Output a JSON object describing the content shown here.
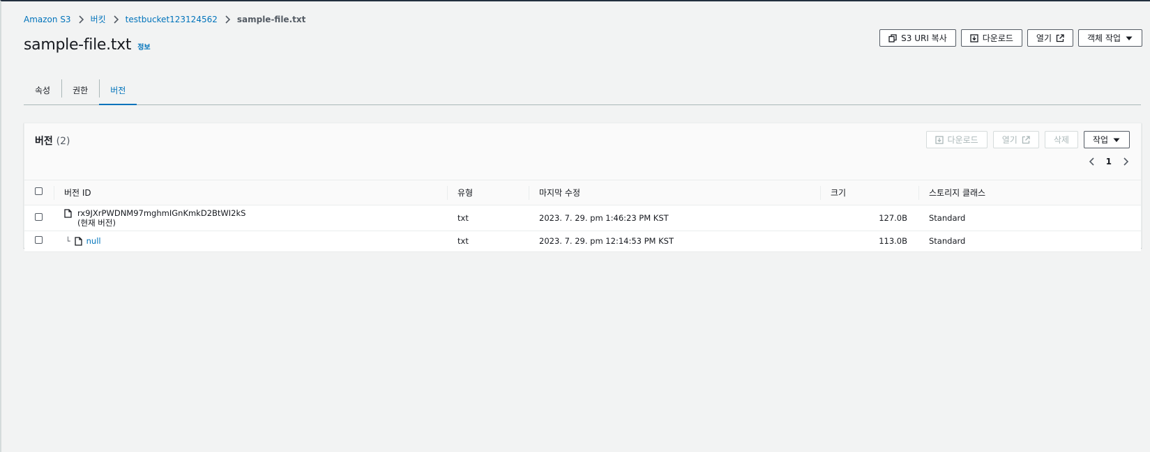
{
  "breadcrumb": {
    "items": [
      "Amazon S3",
      "버킷",
      "testbucket123124562"
    ],
    "current": "sample-file.txt"
  },
  "page": {
    "title": "sample-file.txt",
    "info_link": "정보"
  },
  "header_actions": {
    "copy_uri": "S3 URI 복사",
    "download": "다운로드",
    "open": "열기",
    "object_actions": "객체 작업"
  },
  "tabs": [
    {
      "label": "속성"
    },
    {
      "label": "권한"
    },
    {
      "label": "버전"
    }
  ],
  "versions_panel": {
    "title": "버전",
    "count": "(2)",
    "actions": {
      "download": "다운로드",
      "open": "열기",
      "delete": "삭제",
      "actions": "작업"
    },
    "page": "1",
    "columns": {
      "version_id": "버전 ID",
      "type": "유형",
      "last_modified": "마지막 수정",
      "size": "크기",
      "storage_class": "스토리지 클래스"
    },
    "rows": [
      {
        "version_id": "rx9JXrPWDNM97mghmIGnKmkD2BtWI2kS",
        "current_tag": "(현재 버전)",
        "type": "txt",
        "last_modified": "2023. 7. 29. pm 1:46:23 PM KST",
        "size": "127.0B",
        "storage_class": "Standard"
      },
      {
        "version_id": "null",
        "type": "txt",
        "last_modified": "2023. 7. 29. pm 12:14:53 PM KST",
        "size": "113.0B",
        "storage_class": "Standard"
      }
    ]
  },
  "colors": {
    "link": "#0073bb",
    "text": "#16191f",
    "background": "#f2f3f3",
    "disabled": "#aab7b8"
  }
}
